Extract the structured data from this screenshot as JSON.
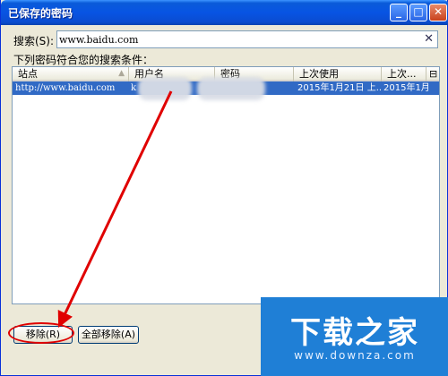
{
  "window": {
    "title": "已保存的密码",
    "min_glyph": "_",
    "max_glyph": "□",
    "close_glyph": "✕"
  },
  "search": {
    "label": "搜索(S):",
    "value": "www.baidu.com",
    "clear_glyph": "✕"
  },
  "list": {
    "caption": "下列密码符合您的搜索条件：",
    "columns": [
      "站点",
      "用户名",
      "密码",
      "上次使用",
      "上次...",
      "⊟"
    ],
    "rows": [
      {
        "site": "http://www.baidu.com",
        "username_prefix": "k",
        "last_used": "2015年1月21日 上...",
        "last_changed": "2015年1月"
      }
    ]
  },
  "buttons": {
    "remove": "移除(R)",
    "remove_all": "全部移除(A)"
  },
  "watermark": {
    "main": "下载之家",
    "sub": "www.downza.com"
  },
  "colors": {
    "accent": "#316ac5",
    "annotation": "#e00000",
    "watermark_bg": "#1f7fd6"
  }
}
